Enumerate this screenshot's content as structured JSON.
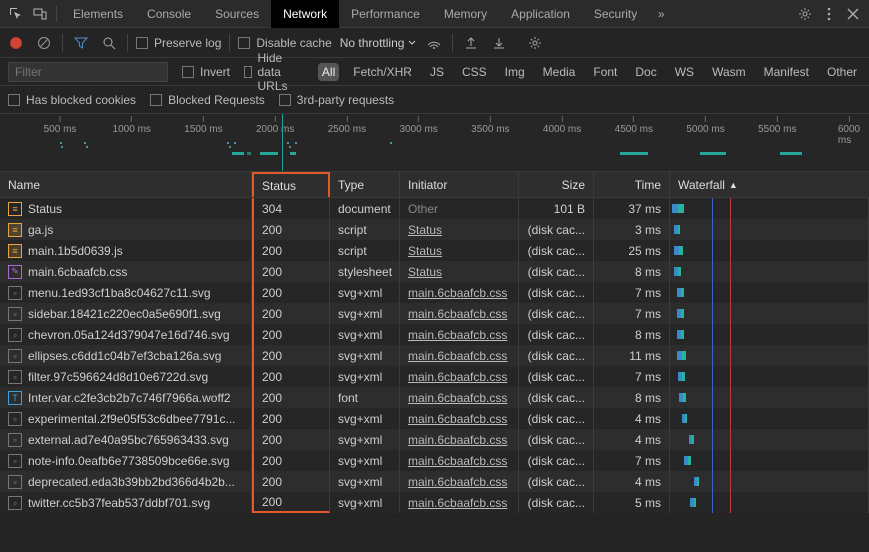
{
  "top": {
    "tabs": [
      "Elements",
      "Console",
      "Sources",
      "Network",
      "Performance",
      "Memory",
      "Application",
      "Security"
    ],
    "active": "Network"
  },
  "toolbar": {
    "preserve_log": "Preserve log",
    "disable_cache": "Disable cache",
    "throttling": "No throttling"
  },
  "filter": {
    "placeholder": "Filter",
    "invert": "Invert",
    "hide_data_urls": "Hide data URLs",
    "types": [
      "All",
      "Fetch/XHR",
      "JS",
      "CSS",
      "Img",
      "Media",
      "Font",
      "Doc",
      "WS",
      "Wasm",
      "Manifest",
      "Other"
    ],
    "active_type": "All",
    "blocked_cookies": "Has blocked cookies",
    "blocked_requests": "Blocked Requests",
    "third_party": "3rd-party requests"
  },
  "timeline": {
    "ticks": [
      "500 ms",
      "1000 ms",
      "1500 ms",
      "2000 ms",
      "2500 ms",
      "3000 ms",
      "3500 ms",
      "4000 ms",
      "4500 ms",
      "5000 ms",
      "5500 ms",
      "6000 ms"
    ]
  },
  "columns": {
    "name": "Name",
    "status": "Status",
    "type": "Type",
    "initiator": "Initiator",
    "size": "Size",
    "time": "Time",
    "waterfall": "Waterfall"
  },
  "rows": [
    {
      "name": "Status",
      "type": "document",
      "status": "304",
      "init": "Other",
      "init_link": false,
      "size": "101 B",
      "time": "37 ms",
      "ico": "doc",
      "wf": {
        "x": 2,
        "w": 6,
        "teal": 6
      }
    },
    {
      "name": "ga.js",
      "type": "script",
      "status": "200",
      "init": "Status",
      "init_link": true,
      "size": "(disk cac...",
      "time": "3 ms",
      "ico": "js",
      "wf": {
        "x": 4,
        "w": 4,
        "teal": 2
      }
    },
    {
      "name": "main.1b5d0639.js",
      "type": "script",
      "status": "200",
      "init": "Status",
      "init_link": true,
      "size": "(disk cac...",
      "time": "25 ms",
      "ico": "js",
      "wf": {
        "x": 4,
        "w": 5,
        "teal": 4
      }
    },
    {
      "name": "main.6cbaafcb.css",
      "type": "stylesheet",
      "status": "200",
      "init": "Status",
      "init_link": true,
      "size": "(disk cac...",
      "time": "8 ms",
      "ico": "css",
      "wf": {
        "x": 4,
        "w": 4,
        "teal": 3
      }
    },
    {
      "name": "menu.1ed93cf1ba8c04627c11.svg",
      "type": "svg+xml",
      "status": "200",
      "init": "main.6cbaafcb.css",
      "init_link": true,
      "size": "(disk cac...",
      "time": "7 ms",
      "ico": "img",
      "wf": {
        "x": 7,
        "w": 4,
        "teal": 3
      }
    },
    {
      "name": "sidebar.18421c220ec0a5e690f1.svg",
      "type": "svg+xml",
      "status": "200",
      "init": "main.6cbaafcb.css",
      "init_link": true,
      "size": "(disk cac...",
      "time": "7 ms",
      "ico": "img",
      "wf": {
        "x": 7,
        "w": 4,
        "teal": 3
      }
    },
    {
      "name": "chevron.05a124d379047e16d746.svg",
      "type": "svg+xml",
      "status": "200",
      "init": "main.6cbaafcb.css",
      "init_link": true,
      "size": "(disk cac...",
      "time": "8 ms",
      "ico": "img",
      "wf": {
        "x": 7,
        "w": 4,
        "teal": 3
      }
    },
    {
      "name": "ellipses.c6dd1c04b7ef3cba126a.svg",
      "type": "svg+xml",
      "status": "200",
      "init": "main.6cbaafcb.css",
      "init_link": true,
      "size": "(disk cac...",
      "time": "11 ms",
      "ico": "img",
      "wf": {
        "x": 7,
        "w": 5,
        "teal": 4
      }
    },
    {
      "name": "filter.97c596624d8d10e6722d.svg",
      "type": "svg+xml",
      "status": "200",
      "init": "main.6cbaafcb.css",
      "init_link": true,
      "size": "(disk cac...",
      "time": "7 ms",
      "ico": "img",
      "wf": {
        "x": 8,
        "w": 4,
        "teal": 3
      }
    },
    {
      "name": "Inter.var.c2fe3cb2b7c746f7966a.woff2",
      "type": "font",
      "status": "200",
      "init": "main.6cbaafcb.css",
      "init_link": true,
      "size": "(disk cac...",
      "time": "8 ms",
      "ico": "font",
      "wf": {
        "x": 9,
        "w": 4,
        "teal": 3
      }
    },
    {
      "name": "experimental.2f9e05f53c6dbee7791c...",
      "type": "svg+xml",
      "status": "200",
      "init": "main.6cbaafcb.css",
      "init_link": true,
      "size": "(disk cac...",
      "time": "4 ms",
      "ico": "img",
      "wf": {
        "x": 12,
        "w": 3,
        "teal": 2
      }
    },
    {
      "name": "external.ad7e40a95bc765963433.svg",
      "type": "svg+xml",
      "status": "200",
      "init": "main.6cbaafcb.css",
      "init_link": true,
      "size": "(disk cac...",
      "time": "4 ms",
      "ico": "img",
      "wf": {
        "x": 19,
        "w": 3,
        "teal": 2
      }
    },
    {
      "name": "note-info.0eafb6e7738509bce66e.svg",
      "type": "svg+xml",
      "status": "200",
      "init": "main.6cbaafcb.css",
      "init_link": true,
      "size": "(disk cac...",
      "time": "7 ms",
      "ico": "img",
      "wf": {
        "x": 14,
        "w": 4,
        "teal": 3
      }
    },
    {
      "name": "deprecated.eda3b39bb2bd366d4b2b...",
      "type": "svg+xml",
      "status": "200",
      "init": "main.6cbaafcb.css",
      "init_link": true,
      "size": "(disk cac...",
      "time": "4 ms",
      "ico": "img",
      "wf": {
        "x": 24,
        "w": 3,
        "teal": 2
      }
    },
    {
      "name": "twitter.cc5b37feab537ddbf701.svg",
      "type": "svg+xml",
      "status": "200",
      "init": "main.6cbaafcb.css",
      "init_link": true,
      "size": "(disk cac...",
      "time": "5 ms",
      "ico": "img",
      "wf": {
        "x": 20,
        "w": 4,
        "teal": 2
      }
    }
  ]
}
